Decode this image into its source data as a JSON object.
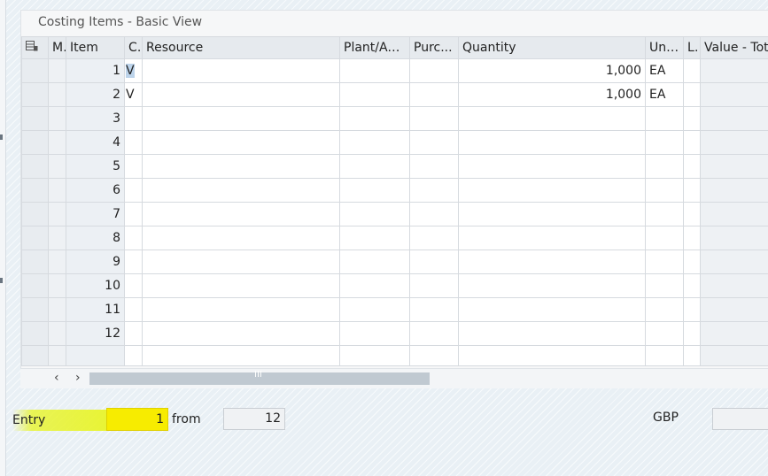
{
  "panel": {
    "title": "Costing Items - Basic View"
  },
  "table": {
    "columns": {
      "m": "M",
      "item": "Item",
      "c": "C.",
      "resource": "Resource",
      "plant": "Plant/Ac...",
      "purc": "Purc...",
      "quantity": "Quantity",
      "unit": "Uni...",
      "l": "L.",
      "value": "Value - Total"
    },
    "rows": [
      {
        "item": "1",
        "c": "V",
        "quantity": "1,000",
        "unit": "EA"
      },
      {
        "item": "2",
        "c": "V",
        "quantity": "1,000",
        "unit": "EA"
      },
      {
        "item": "3"
      },
      {
        "item": "4"
      },
      {
        "item": "5"
      },
      {
        "item": "6"
      },
      {
        "item": "7"
      },
      {
        "item": "8"
      },
      {
        "item": "9"
      },
      {
        "item": "10"
      },
      {
        "item": "11"
      },
      {
        "item": "12"
      }
    ]
  },
  "scrollbar": {
    "left_arrow": "‹",
    "right_arrow": "›",
    "grip": "III"
  },
  "footer": {
    "entry_label": "Entry",
    "entry_value": "1",
    "from_label": "from",
    "total_entries": "12",
    "currency_label": "GBP",
    "currency_value": ""
  },
  "colors": {
    "highlight": "#f7ec00",
    "header_bg": "#e6eaee",
    "selection": "#bcd3ea"
  }
}
